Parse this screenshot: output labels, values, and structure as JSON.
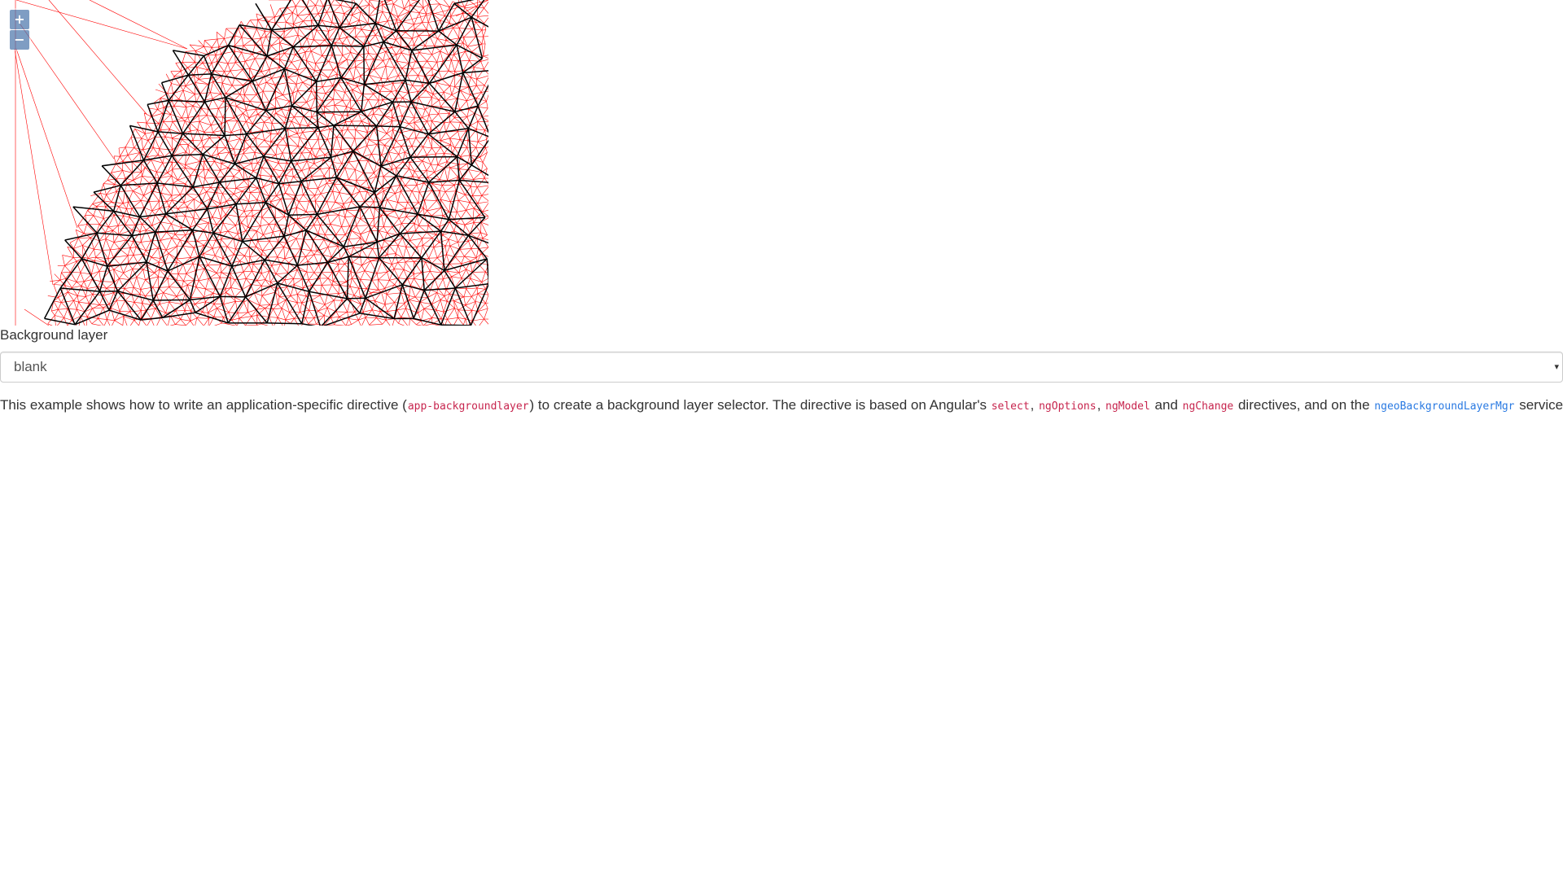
{
  "map": {
    "zoom_in_label": "+",
    "zoom_out_label": "−",
    "line_colors": {
      "fine": "#ff0000",
      "coarse": "#000000"
    }
  },
  "form": {
    "label": "Background layer",
    "selected": "blank"
  },
  "description": {
    "t1": "This example shows how to write an application-specific directive (",
    "c1": "app-backgroundlayer",
    "t2": ") to create a background layer selector. The directive is based on Angular's ",
    "c2": "select",
    "t3": ", ",
    "c3": "ngOptions",
    "t4": ", ",
    "c4": "ngModel",
    "t5": " and ",
    "c5": "ngChange",
    "t6": " directives, and on the ",
    "c6": "ngeoBackgroundLayerMgr",
    "t7": " service."
  }
}
